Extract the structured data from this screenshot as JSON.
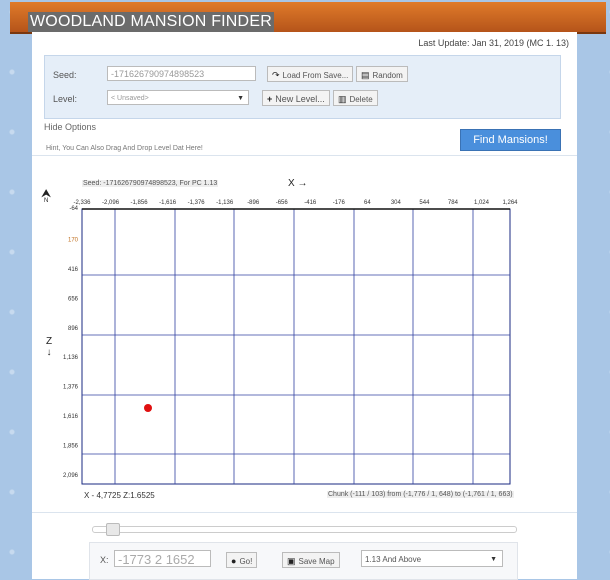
{
  "app": {
    "title": "WOODLAND MANSION FINDER"
  },
  "last_update": "Last Update: Jan 31, 2019 (MC 1. 13)",
  "form": {
    "seed_label": "Seed:",
    "seed_value": "-171626790974898523",
    "load_label": "Load From Save...",
    "random_label": "Random",
    "level_label": "Level:",
    "level_value": "< Unsaved>",
    "new_label": "New Level...",
    "delete_label": "Delete"
  },
  "hide_options": "Hide Options",
  "hint": "Hint, You Can Also Drag And Drop Level Dat Here!",
  "find_button": "Find Mansions!",
  "map": {
    "seed_line": "Seed: -171626790974898523, For PC 1.13",
    "x_axis_label": "X →",
    "z_axis_label": "Z",
    "z_arrow": "↓",
    "compass": "N",
    "x_ticks": [
      "-2,336",
      "-2,096",
      "-1,856",
      "-1,616",
      "-1,376",
      "-1,136",
      "-896",
      "-656",
      "-416",
      "-176",
      "64",
      "304",
      "544",
      "784",
      "1,024",
      "1,264"
    ],
    "z_ticks": [
      "-64",
      "170",
      "416",
      "656",
      "896",
      "1,136",
      "1,376",
      "1,616",
      "1,856",
      "2,096"
    ],
    "coords": "X - 4,7725 Z:1.6525",
    "chunk": "Chunk (-111 / 103) from (-1,776 / 1, 648) to (-1,761 / 1, 663)",
    "marker_color": "#e01010"
  },
  "controls": {
    "x_label": "X:",
    "coord_value": "-1773 2 1652",
    "go_label": "Go!",
    "save_map_label": "Save Map",
    "version_value": "1.13 And Above"
  }
}
